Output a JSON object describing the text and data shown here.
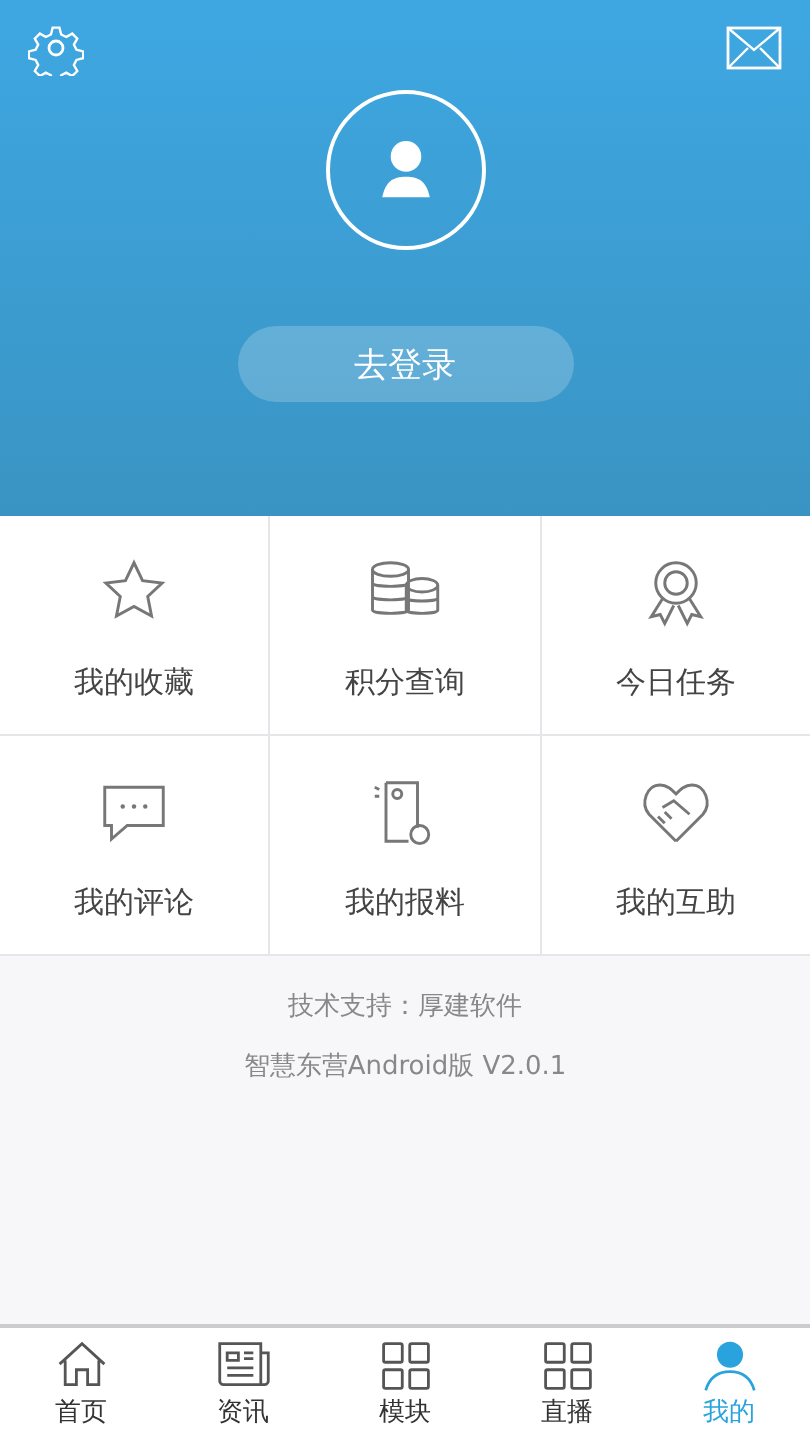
{
  "header": {
    "login_button": "去登录"
  },
  "grid": [
    {
      "label": "我的收藏"
    },
    {
      "label": "积分查询"
    },
    {
      "label": "今日任务"
    },
    {
      "label": "我的评论"
    },
    {
      "label": "我的报料"
    },
    {
      "label": "我的互助"
    }
  ],
  "footer": {
    "support": "技术支持：厚建软件",
    "version": "智慧东营Android版 V2.0.1"
  },
  "tabs": [
    {
      "label": "首页",
      "selected": false
    },
    {
      "label": "资讯",
      "selected": false
    },
    {
      "label": "模块",
      "selected": false
    },
    {
      "label": "直播",
      "selected": false
    },
    {
      "label": "我的",
      "selected": true
    }
  ]
}
